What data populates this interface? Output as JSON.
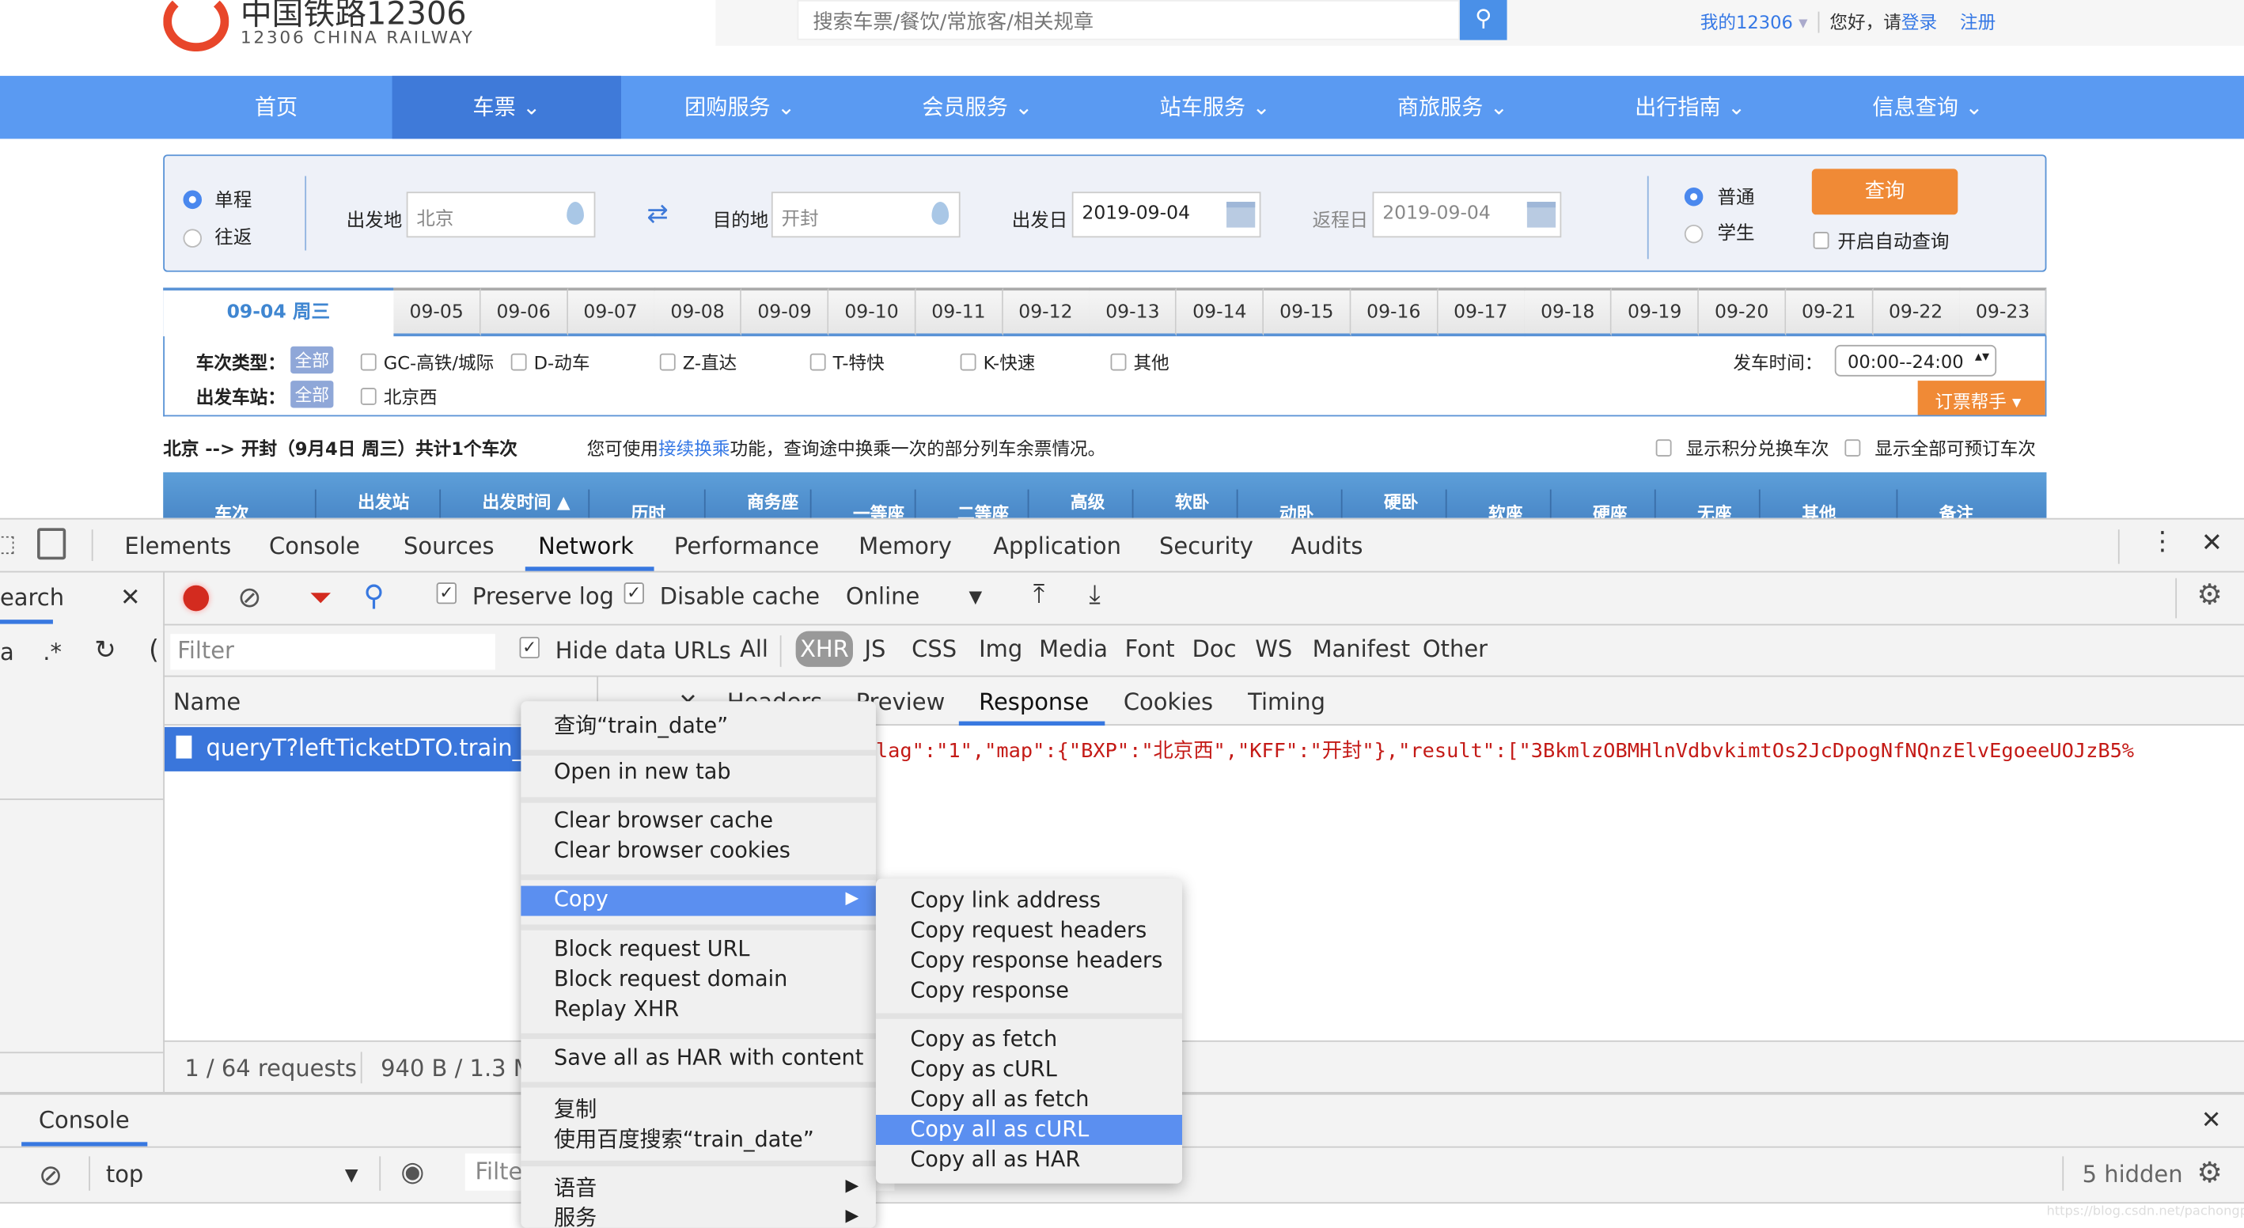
{
  "header": {
    "logo_title": "中国铁路12306",
    "logo_subtitle": "12306 CHINA RAILWAY",
    "search_placeholder": "搜索车票/餐饮/常旅客/相关规章",
    "my12306": "我的12306",
    "greeting": "您好，请",
    "login": "登录",
    "register": "注册"
  },
  "nav": [
    {
      "label": "首页"
    },
    {
      "label": "车票",
      "active": true
    },
    {
      "label": "团购服务"
    },
    {
      "label": "会员服务"
    },
    {
      "label": "站车服务"
    },
    {
      "label": "商旅服务"
    },
    {
      "label": "出行指南"
    },
    {
      "label": "信息查询"
    }
  ],
  "form": {
    "one_way": "单程",
    "round_trip": "往返",
    "from_label": "出发地",
    "from_value": "北京",
    "to_label": "目的地",
    "to_value": "开封",
    "depart_label": "出发日",
    "depart_value": "2019-09-04",
    "return_label": "返程日",
    "return_value": "2019-09-04",
    "normal": "普通",
    "student": "学生",
    "query_button": "查询",
    "auto_query": "开启自动查询"
  },
  "dates": {
    "active": "09-04 周三",
    "others": [
      "09-05",
      "09-06",
      "09-07",
      "09-08",
      "09-09",
      "09-10",
      "09-11",
      "09-12",
      "09-13",
      "09-14",
      "09-15",
      "09-16",
      "09-17",
      "09-18",
      "09-19",
      "09-20",
      "09-21",
      "09-22",
      "09-23"
    ]
  },
  "filters": {
    "type_label": "车次类型：",
    "all": "全部",
    "types": [
      "GC-高铁/城际",
      "D-动车",
      "Z-直达",
      "T-特快",
      "K-快速",
      "其他"
    ],
    "station_label": "出发车站：",
    "stations": [
      "北京西"
    ],
    "time_label": "发车时间：",
    "time_value": "00:00--24:00",
    "helper": "订票帮手"
  },
  "summary": {
    "route": "北京 --> 开封（9月4日  周三）共计1个车次",
    "tip_pre": "您可使用",
    "tip_link": "接续换乘",
    "tip_post": "功能，查询途中换乘一次的部分列车余票情况。",
    "opt1": "显示积分兑换车次",
    "opt2": "显示全部可预订车次"
  },
  "table_headers": [
    "车次",
    "出发站",
    "出发时间 ▲",
    "历时",
    "商务座",
    "一等座",
    "二等座",
    "高级",
    "软卧",
    "动卧",
    "硬卧",
    "软座",
    "硬座",
    "无座",
    "其他",
    "备注"
  ],
  "devtools": {
    "tabs": [
      "Elements",
      "Console",
      "Sources",
      "Network",
      "Performance",
      "Memory",
      "Application",
      "Security",
      "Audits"
    ],
    "active_tab": "Network",
    "search_label": "earch",
    "preserve_log": "Preserve log",
    "disable_cache": "Disable cache",
    "throttle": "Online",
    "filter_placeholder": "Filter",
    "hide_data_urls": "Hide data URLs",
    "types": [
      "All",
      "XHR",
      "JS",
      "CSS",
      "Img",
      "Media",
      "Font",
      "Doc",
      "WS",
      "Manifest",
      "Other"
    ],
    "active_type": "XHR",
    "name_header": "Name",
    "detail_tabs": [
      "Headers",
      "Preview",
      "Response",
      "Cookies",
      "Timing"
    ],
    "active_detail": "Response",
    "request": "queryT?leftTicketDTO.train_d",
    "response": "lag\":\"1\",\"map\":{\"BXP\":\"北京西\",\"KFF\":\"开封\"},\"result\":[\"3BkmlzOBMHlnVdbvkimtOs2JcDpogNfNQnzElvEgoeeUOJzB5%",
    "status_requests": "1 / 64 requests",
    "status_size": "940 B / 1.3 M",
    "drawer_tab": "Console",
    "context": "top",
    "console_filter": "Filte",
    "hidden": "5 hidden"
  },
  "context_menu": {
    "items": [
      "查询“train_date”",
      "Open in new tab",
      "Clear browser cache",
      "Clear browser cookies",
      "Copy",
      "Block request URL",
      "Block request domain",
      "Replay XHR",
      "Save all as HAR with content",
      "复制",
      "使用百度搜索“train_date”",
      "语音",
      "服务"
    ]
  },
  "copy_submenu": {
    "items": [
      "Copy link address",
      "Copy request headers",
      "Copy response headers",
      "Copy response",
      "Copy as fetch",
      "Copy as cURL",
      "Copy all as fetch",
      "Copy all as cURL",
      "Copy all as HAR"
    ],
    "highlighted": "Copy all as cURL"
  },
  "watermark": "https://blog.csdn.net/pachongpapa"
}
